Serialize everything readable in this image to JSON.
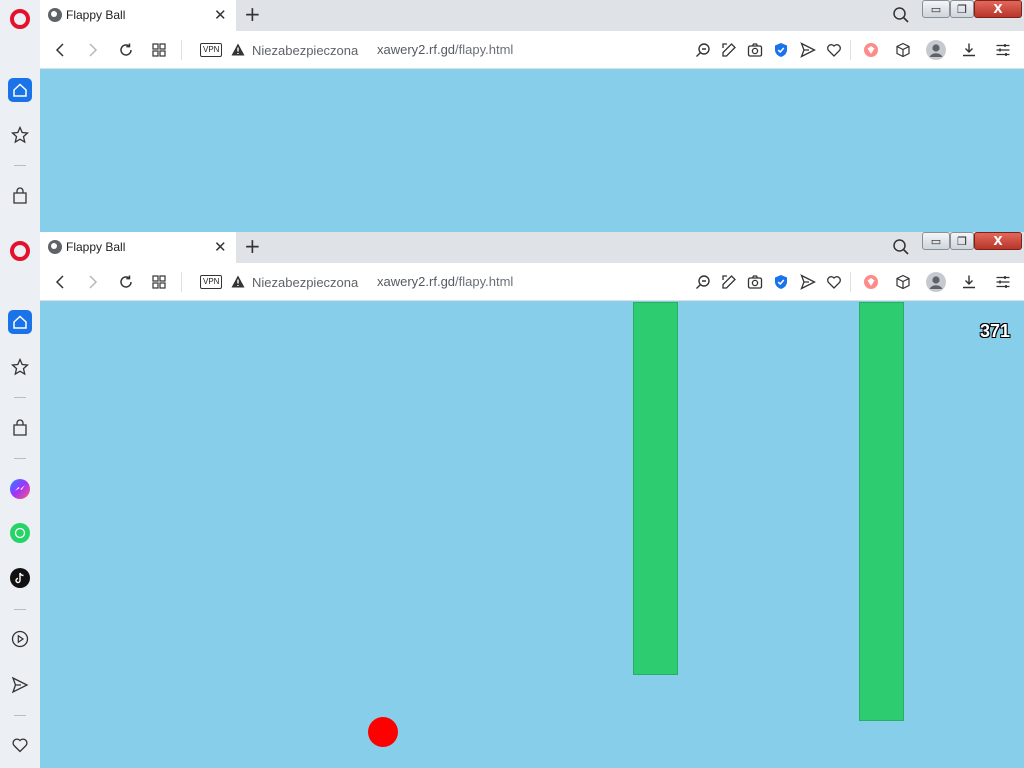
{
  "browser": {
    "tab": {
      "title": "Flappy Ball",
      "favicon": "globe-icon"
    },
    "new_tab_label": "+",
    "close_tab_label": "✕",
    "window_controls": {
      "minimize": "▭",
      "restore": "❐",
      "close": "X"
    },
    "vpn_label": "VPN",
    "security_label": "Niezabezpieczona",
    "url_host": "xawery2.rf.gd",
    "url_path": "/flapy.html"
  },
  "sidebar": {
    "items": [
      "opera-logo-icon",
      "home-icon",
      "bookmarks-star-icon",
      "shopping-bag-icon",
      "messenger-icon",
      "whatsapp-icon",
      "tiktok-icon",
      "player-icon",
      "send-icon",
      "heart-icon"
    ]
  },
  "game": {
    "score": "371",
    "colors": {
      "sky": "#87ceeb",
      "pipe": "#2ecc71",
      "ball": "#ff0000"
    }
  }
}
